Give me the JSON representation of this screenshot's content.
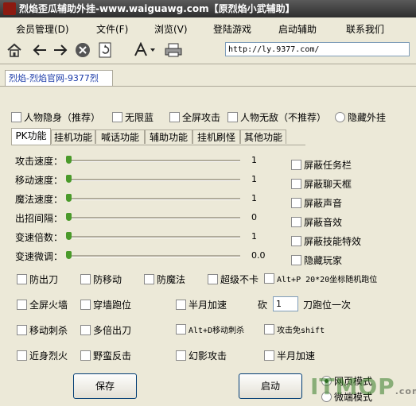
{
  "title": "烈焰歪瓜辅助外挂-www.waiguawg.com【原烈焰小武辅助】",
  "menu": [
    "会员管理(D)",
    "文件(F)",
    "浏览(V)",
    "登陆游戏",
    "启动辅助",
    "联系我们"
  ],
  "toolbar": {
    "icons": [
      "home-icon",
      "back-icon",
      "forward-icon",
      "stop-icon",
      "refresh-icon",
      "font-icon",
      "print-icon"
    ],
    "url": "http://ly.9377.com/"
  },
  "browser_tab": "烈焰-烈焰官网-9377烈",
  "top_options": [
    {
      "label": "人物隐身（推荐）",
      "checked": false
    },
    {
      "label": "无限蓝",
      "checked": false
    },
    {
      "label": "全屏攻击",
      "checked": false
    },
    {
      "label": "人物无敌（不推荐）",
      "checked": false
    }
  ],
  "hide_plugin": {
    "label": "隐藏外挂",
    "selected": false
  },
  "feature_tabs": [
    "PK功能",
    "挂机功能",
    "喊话功能",
    "辅助功能",
    "挂机刷怪",
    "其他功能"
  ],
  "active_tab": "PK功能",
  "sliders": [
    {
      "label": "攻击速度：",
      "value": "1"
    },
    {
      "label": "移动速度：",
      "value": "1"
    },
    {
      "label": "魔法速度：",
      "value": "1"
    },
    {
      "label": "出招间隔：",
      "value": "0"
    },
    {
      "label": "变速倍数：",
      "value": "1"
    },
    {
      "label": "变速微调：",
      "value": "0.0"
    }
  ],
  "right_checks": [
    "屏蔽任务栏",
    "屏蔽聊天框",
    "屏蔽声音",
    "屏蔽音效",
    "屏蔽技能特效",
    "隐藏玩家"
  ],
  "row1": [
    "防出刀",
    "防移动",
    "防魔法",
    "超级不卡",
    "Alt+P 20*20坐标随机跑位"
  ],
  "row2": [
    "全屏火墙",
    "穿墙跑位",
    "半月加速"
  ],
  "chop": {
    "prefix": "砍",
    "value": "1",
    "suffix": "刀跑位一次"
  },
  "row3": [
    "移动刺杀",
    "多倍出刀",
    "Alt+D移动刺杀",
    "攻击免shift"
  ],
  "row4": [
    "近身烈火",
    "野蛮反击",
    "幻影攻击",
    "半月加速"
  ],
  "buttons": {
    "save": "保存",
    "start": "启动"
  },
  "modes": [
    {
      "label": "网页模式",
      "selected": true
    },
    {
      "label": "微端模式",
      "selected": false
    }
  ],
  "watermark": {
    "main": "ITMOP",
    "sub": ".com"
  }
}
